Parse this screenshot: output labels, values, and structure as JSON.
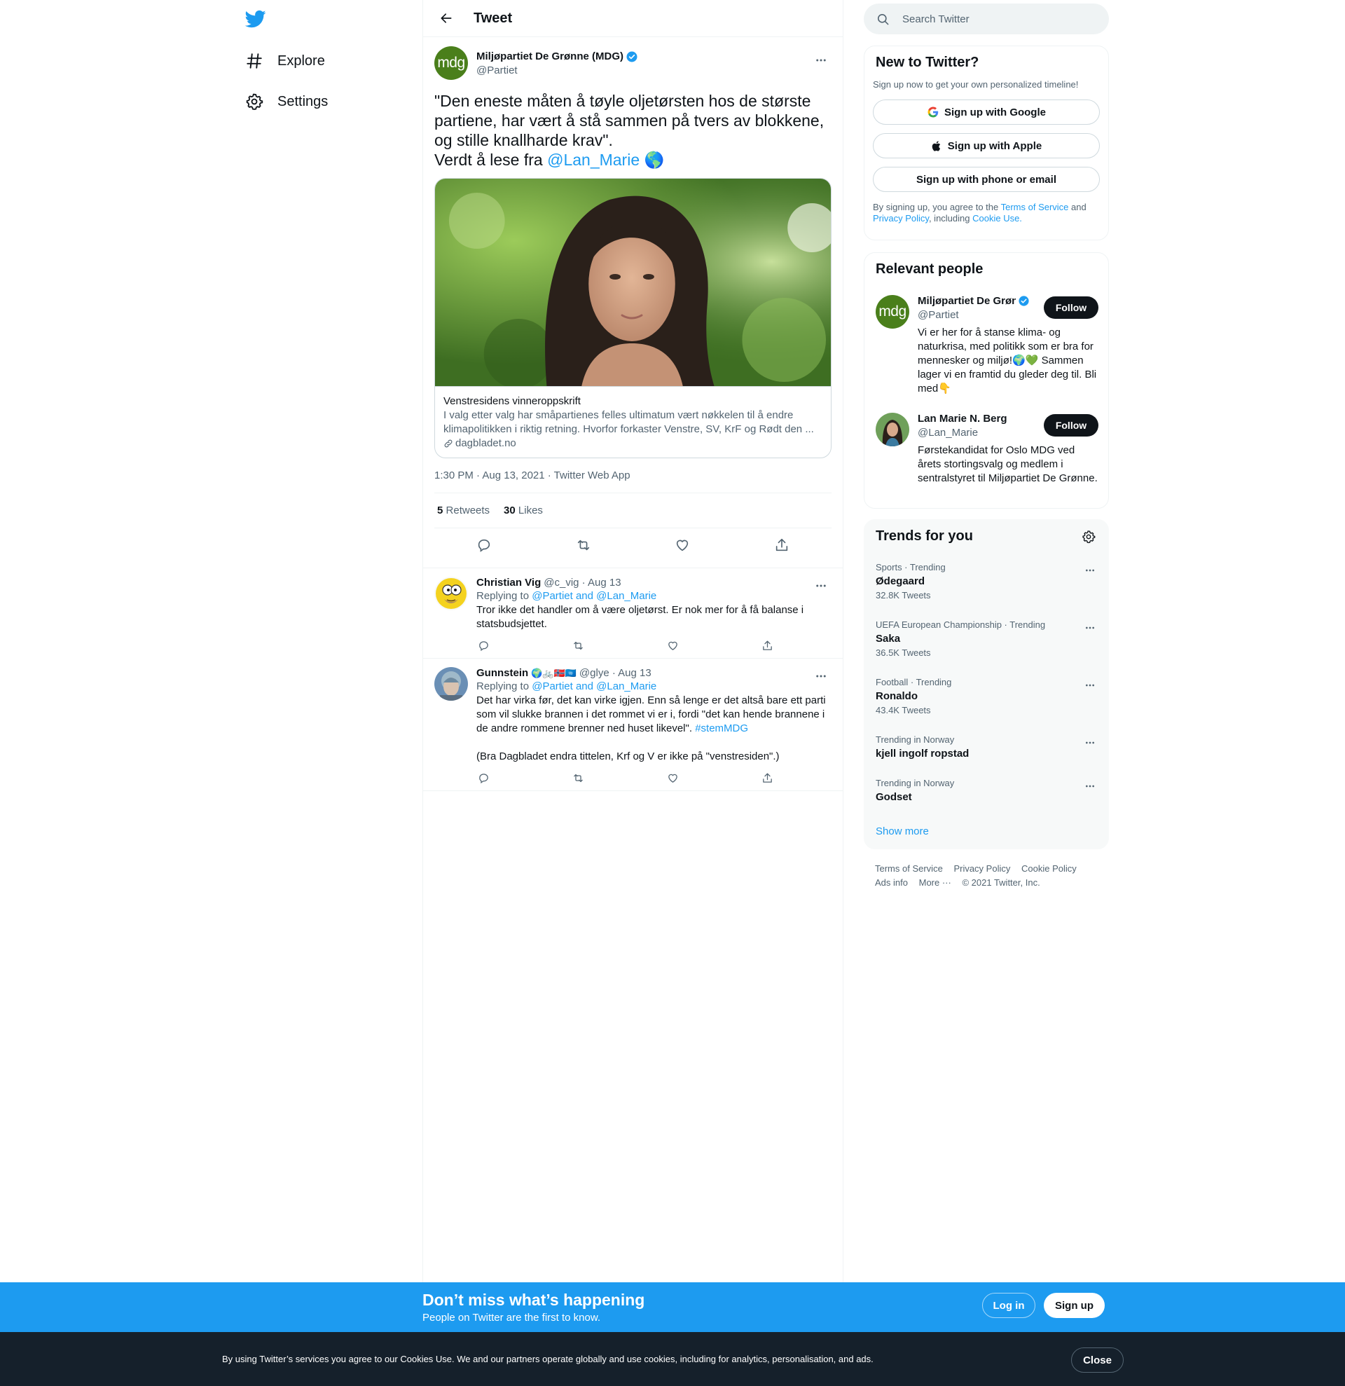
{
  "nav": {
    "logo": "twitter-bird-icon",
    "items": [
      {
        "label": "Explore",
        "icon": "hashtag-icon"
      },
      {
        "label": "Settings",
        "icon": "gear-icon"
      }
    ]
  },
  "header": {
    "title": "Tweet"
  },
  "tweet": {
    "author_name": "Miljøpartiet De Grønne (MDG)",
    "author_handle": "@Partiet",
    "avatar_text": "mdg",
    "text_line1": "\"Den eneste måten å tøyle oljetørsten hos de største partiene, har vært å stå sammen på tvers av blokkene, og stille knallharde krav\".",
    "text_line2": "Verdt å lese fra ",
    "mention": "@Lan_Marie",
    "emoji": "🌎",
    "card": {
      "title": "Venstresidens vinneroppskrift",
      "description": "I valg etter valg har småpartienes felles ultimatum vært nøkkelen til å endre klimapolitikken i riktig retning. Hvorfor forkaster Venstre, SV, KrF og Rødt den ...",
      "domain": "dagbladet.no"
    },
    "meta": "1:30 PM · Aug 13, 2021 · Twitter Web App",
    "retweets": "5",
    "retweets_label": "Retweets",
    "likes": "30",
    "likes_label": "Likes"
  },
  "replies": [
    {
      "name": "Christian Vig",
      "handle": "@c_vig · Aug 13",
      "replying_prefix": "Replying to ",
      "replying_to": "@Partiet and @Lan_Marie",
      "text": "Tror ikke det handler om å være oljetørst. Er nok mer for å få balanse i statsbudsjettet."
    },
    {
      "name": "Gunnstein",
      "name_emoji": "🌍🚲🇳🇴🇺🇳",
      "handle": "@glye · Aug 13",
      "replying_prefix": "Replying to ",
      "replying_to": "@Partiet and @Lan_Marie",
      "text": "Det har virka før, det kan virke igjen. Enn så lenge er det altså bare ett parti som vil slukke brannen i det rommet vi er i, fordi \"det kan hende brannene i de andre rommene brenner ned huset likevel\". ",
      "hashtag": "#stemMDG",
      "text2": "(Bra Dagbladet endra tittelen, Krf og V er ikke på \"venstresiden\".)"
    }
  ],
  "search": {
    "placeholder": "Search Twitter"
  },
  "signup_panel": {
    "title": "New to Twitter?",
    "subtitle": "Sign up now to get your own personalized timeline!",
    "google": "Sign up with Google",
    "apple": "Sign up with Apple",
    "phone": "Sign up with phone or email",
    "terms_1": "By signing up, you agree to the ",
    "terms_tos": "Terms of Service",
    "terms_2": " and ",
    "terms_pp": "Privacy Policy",
    "terms_3": ", including ",
    "terms_cookie": "Cookie Use."
  },
  "people_panel": {
    "title": "Relevant people",
    "people": [
      {
        "name": "Miljøpartiet De Grønne (MDG)",
        "handle": "@Partiet",
        "follow": "Follow",
        "bio": "Vi er her for å stanse klima- og naturkrisa, med politikk som er bra for mennesker og miljø!🌍💚 Sammen lager vi en framtid du gleder deg til. Bli med👇"
      },
      {
        "name": "Lan Marie N. Berg",
        "handle": "@Lan_Marie",
        "follow": "Follow",
        "bio": "Førstekandidat for Oslo MDG ved årets stortingsvalg og medlem i sentralstyret til Miljøpartiet De Grønne."
      }
    ]
  },
  "trends_panel": {
    "title": "Trends for you",
    "trends": [
      {
        "meta": "Sports · Trending",
        "name": "Ødegaard",
        "count": "32.8K Tweets"
      },
      {
        "meta": "UEFA European Championship · Trending",
        "name": "Saka",
        "count": "36.5K Tweets"
      },
      {
        "meta": "Football · Trending",
        "name": "Ronaldo",
        "count": "43.4K Tweets"
      },
      {
        "meta": "Trending in Norway",
        "name": "kjell ingolf ropstad",
        "count": ""
      },
      {
        "meta": "Trending in Norway",
        "name": "Godset",
        "count": ""
      }
    ],
    "show_more": "Show more"
  },
  "footer": {
    "tos": "Terms of Service",
    "privacy": "Privacy Policy",
    "cookie": "Cookie Policy",
    "ads": "Ads info",
    "more": "More ···",
    "copyright": "© 2021 Twitter, Inc."
  },
  "bottom_bar": {
    "title": "Don’t miss what’s happening",
    "subtitle": "People on Twitter are the first to know.",
    "login": "Log in",
    "signup": "Sign up"
  },
  "cookie_bar": {
    "text": "By using Twitter’s services you agree to our Cookies Use. We and our partners operate globally and use cookies, including for analytics, personalisation, and ads.",
    "close": "Close"
  },
  "colors": {
    "accent": "#1d9bf0",
    "text": "#0f1419",
    "muted": "#536471",
    "mdg_green": "#4a7f1b"
  }
}
